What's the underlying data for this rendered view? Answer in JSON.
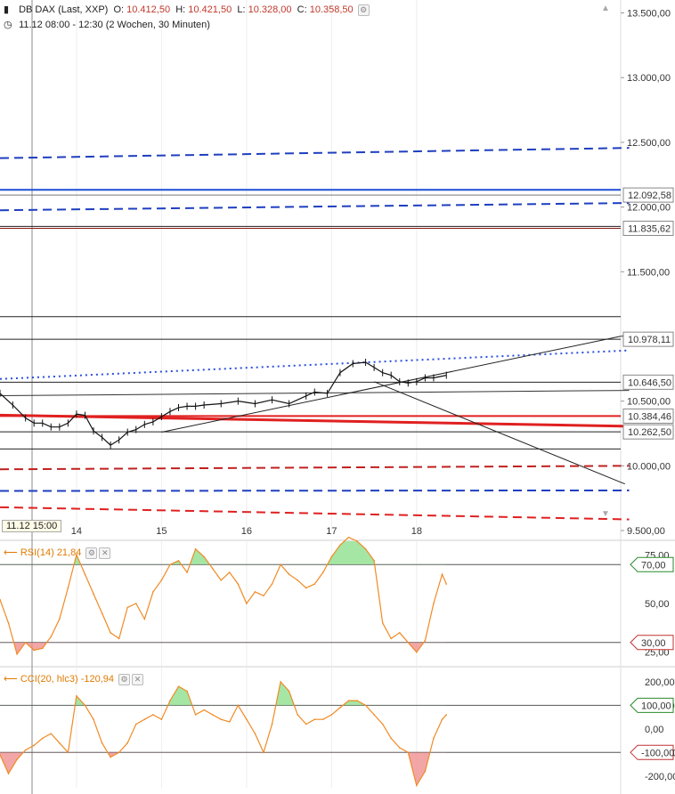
{
  "header": {
    "instrument": "DB DAX (Last, XXP)",
    "ohlc": [
      {
        "k": "O:",
        "v": "10.412,50"
      },
      {
        "k": "H:",
        "v": "10.421,50"
      },
      {
        "k": "L:",
        "v": "10.328,00"
      },
      {
        "k": "C:",
        "v": "10.358,50"
      }
    ],
    "range": "11.12 08:00 - 12:30 (2 Wochen, 30 Minuten)"
  },
  "crosshair_label": "11.12 15:00",
  "chart_data": [
    {
      "type": "line",
      "title": "",
      "y_ticks": [
        "13.500,00",
        "13.000,00",
        "12.500,00",
        "12.000,00",
        "11.500,00",
        "11.000,00",
        "10.500,00",
        "10.000,00",
        "9.500,00"
      ],
      "y_tick_values": [
        13500,
        13000,
        12500,
        12000,
        11500,
        11000,
        10500,
        10000,
        9500
      ],
      "x_ticks": [
        "14",
        "15",
        "16",
        "17",
        "18"
      ],
      "x_tick_values": [
        1.5,
        2.5,
        3.5,
        4.5,
        5.5
      ],
      "xlim": [
        0.6,
        7.9
      ],
      "ylim": [
        9500,
        13600
      ],
      "price_labels": [
        {
          "text": "12.092,58",
          "value": 12092.58,
          "color": "#333333"
        },
        {
          "text": "11.835,62",
          "value": 11835.62,
          "color": "#333333"
        },
        {
          "text": "10.978,11",
          "value": 10978.11,
          "color": "#333333"
        },
        {
          "text": "10.646,50",
          "value": 10646.5,
          "color": "#333333"
        },
        {
          "text": "10.384,46",
          "value": 10384.46,
          "color": "#333333"
        },
        {
          "text": "10.262,50",
          "value": 10262.5,
          "color": "#333333"
        }
      ],
      "horizontal_lines": [
        {
          "value": 12133,
          "color": "#1f4fd6",
          "style": "solid",
          "width": 2
        },
        {
          "value": 12092.58,
          "color": "#777777",
          "style": "solid",
          "width": 1
        },
        {
          "value": 11850,
          "color": "#222222",
          "style": "solid",
          "width": 1
        },
        {
          "value": 11835.62,
          "color": "#8b1a1a",
          "style": "solid",
          "width": 1
        },
        {
          "value": 11153,
          "color": "#222222",
          "style": "solid",
          "width": 1
        },
        {
          "value": 10978.11,
          "color": "#222222",
          "style": "solid",
          "width": 1
        },
        {
          "value": 10646.5,
          "color": "#222222",
          "style": "solid",
          "width": 1
        },
        {
          "value": 10384.46,
          "color": "#e02020",
          "style": "solid",
          "width": 2
        },
        {
          "value": 10262.5,
          "color": "#222222",
          "style": "solid",
          "width": 1
        },
        {
          "value": 10130,
          "color": "#222222",
          "style": "solid",
          "width": 1
        }
      ],
      "trend_lines": [
        {
          "x1": 0.6,
          "y1": 12378,
          "x2": 8.0,
          "y2": 12457,
          "color": "#1f3fbf",
          "style": "dashed",
          "width": 2
        },
        {
          "x1": 0.6,
          "y1": 11975,
          "x2": 8.0,
          "y2": 12031,
          "color": "#1f3fbf",
          "style": "dashed",
          "width": 2
        },
        {
          "x1": 0.6,
          "y1": 10671,
          "x2": 8.0,
          "y2": 10892,
          "color": "#2a4fe0",
          "style": "dotted",
          "width": 2
        },
        {
          "x1": 0.6,
          "y1": 10542,
          "x2": 8.0,
          "y2": 10583,
          "color": "#333333",
          "style": "solid",
          "width": 1
        },
        {
          "x1": 0.6,
          "y1": 10392,
          "x2": 8.0,
          "y2": 10306,
          "color": "#e02020",
          "style": "solid",
          "width": 3
        },
        {
          "x1": 2.5,
          "y1": 10260,
          "x2": 8.0,
          "y2": 11015,
          "color": "#222222",
          "style": "solid",
          "width": 1
        },
        {
          "x1": 5.0,
          "y1": 10650,
          "x2": 7.95,
          "y2": 9860,
          "color": "#222222",
          "style": "solid",
          "width": 1
        },
        {
          "x1": 0.6,
          "y1": 9973,
          "x2": 8.0,
          "y2": 10000,
          "color": "#c02020",
          "style": "dashed",
          "width": 2
        },
        {
          "x1": 0.6,
          "y1": 9806,
          "x2": 8.0,
          "y2": 9810,
          "color": "#1f3fbf",
          "style": "dashed",
          "width": 2
        },
        {
          "x1": 0.6,
          "y1": 9680,
          "x2": 8.0,
          "y2": 9586,
          "color": "#e02020",
          "style": "dashed",
          "width": 2
        }
      ],
      "series": [
        {
          "color": "#111111",
          "x": [
            0.6,
            0.75,
            0.9,
            1.0,
            1.1,
            1.2,
            1.3,
            1.4,
            1.5,
            1.6,
            1.7,
            1.8,
            1.9,
            2.0,
            2.1,
            2.2,
            2.3,
            2.4,
            2.5,
            2.6,
            2.7,
            2.8,
            2.9,
            3.0,
            3.2,
            3.4,
            3.6,
            3.8,
            4.0,
            4.2,
            4.3,
            4.45,
            4.6,
            4.75,
            4.9,
            5.0,
            5.1,
            5.2,
            5.3,
            5.4,
            5.5,
            5.6,
            5.7,
            5.85
          ],
          "values": [
            10560,
            10470,
            10370,
            10330,
            10330,
            10300,
            10300,
            10330,
            10400,
            10390,
            10270,
            10220,
            10160,
            10200,
            10260,
            10280,
            10320,
            10340,
            10380,
            10420,
            10450,
            10460,
            10460,
            10470,
            10480,
            10500,
            10480,
            10510,
            10480,
            10540,
            10570,
            10560,
            10720,
            10790,
            10800,
            10760,
            10720,
            10700,
            10650,
            10640,
            10650,
            10680,
            10680,
            10700
          ]
        }
      ]
    },
    {
      "type": "line",
      "title": "",
      "indicator": "RSI(14)",
      "value": "21,84",
      "y_ticks": [
        "75,00",
        "70,00",
        "50,00",
        "30,00",
        "25,00"
      ],
      "y_tick_values": [
        75,
        70,
        50,
        30,
        25
      ],
      "ylim": [
        18,
        82
      ],
      "bands": [
        70,
        30
      ],
      "band_labels": [
        {
          "text": "70,00",
          "value": 70,
          "color": "#2a8a2a"
        },
        {
          "text": "30,00",
          "value": 30,
          "color": "#c03030"
        }
      ],
      "series": [
        {
          "color": "#f08a24",
          "x": [
            0.6,
            0.7,
            0.8,
            0.9,
            1.0,
            1.1,
            1.2,
            1.3,
            1.4,
            1.5,
            1.6,
            1.7,
            1.8,
            1.9,
            2.0,
            2.1,
            2.2,
            2.3,
            2.4,
            2.5,
            2.6,
            2.7,
            2.8,
            2.9,
            3.0,
            3.1,
            3.2,
            3.3,
            3.4,
            3.5,
            3.6,
            3.7,
            3.8,
            3.9,
            4.0,
            4.1,
            4.2,
            4.3,
            4.4,
            4.5,
            4.6,
            4.7,
            4.8,
            4.9,
            5.0,
            5.1,
            5.2,
            5.3,
            5.4,
            5.5,
            5.6,
            5.7,
            5.8,
            5.85
          ],
          "values": [
            52,
            40,
            24,
            30,
            26,
            27,
            33,
            42,
            58,
            75,
            65,
            55,
            45,
            35,
            32,
            48,
            50,
            42,
            56,
            62,
            70,
            72,
            66,
            78,
            74,
            68,
            62,
            66,
            60,
            50,
            56,
            54,
            60,
            70,
            65,
            62,
            58,
            60,
            66,
            74,
            80,
            84,
            82,
            78,
            72,
            40,
            32,
            35,
            30,
            25,
            31,
            50,
            65,
            60
          ]
        }
      ]
    },
    {
      "type": "line",
      "title": "",
      "indicator": "CCI(20, hlc3)",
      "value": "-120,94",
      "y_ticks": [
        "200,00",
        "100,00",
        "0,00",
        "-100,00",
        "-200,00"
      ],
      "y_tick_values": [
        200,
        100,
        0,
        -100,
        -200
      ],
      "ylim": [
        -250,
        260
      ],
      "bands": [
        100,
        -100
      ],
      "band_labels": [
        {
          "text": "100,00",
          "value": 100,
          "color": "#2a8a2a"
        },
        {
          "text": "-100,00",
          "value": -100,
          "color": "#c03030"
        }
      ],
      "series": [
        {
          "color": "#f08a24",
          "x": [
            0.6,
            0.7,
            0.8,
            0.9,
            1.0,
            1.1,
            1.2,
            1.3,
            1.4,
            1.5,
            1.6,
            1.7,
            1.8,
            1.9,
            2.0,
            2.1,
            2.2,
            2.3,
            2.4,
            2.5,
            2.6,
            2.7,
            2.8,
            2.9,
            3.0,
            3.1,
            3.2,
            3.3,
            3.4,
            3.5,
            3.6,
            3.7,
            3.8,
            3.9,
            4.0,
            4.1,
            4.2,
            4.3,
            4.4,
            4.5,
            4.6,
            4.7,
            4.8,
            4.9,
            5.0,
            5.1,
            5.2,
            5.3,
            5.4,
            5.5,
            5.6,
            5.7,
            5.8,
            5.85
          ],
          "values": [
            -110,
            -190,
            -130,
            -90,
            -70,
            -40,
            -20,
            -60,
            -100,
            140,
            100,
            40,
            -60,
            -120,
            -100,
            -60,
            20,
            40,
            60,
            40,
            120,
            180,
            160,
            60,
            80,
            60,
            40,
            30,
            100,
            40,
            -20,
            -100,
            20,
            200,
            160,
            60,
            20,
            40,
            40,
            60,
            90,
            120,
            120,
            100,
            60,
            20,
            -40,
            -80,
            -100,
            -240,
            -180,
            -40,
            40,
            60
          ]
        }
      ]
    }
  ]
}
